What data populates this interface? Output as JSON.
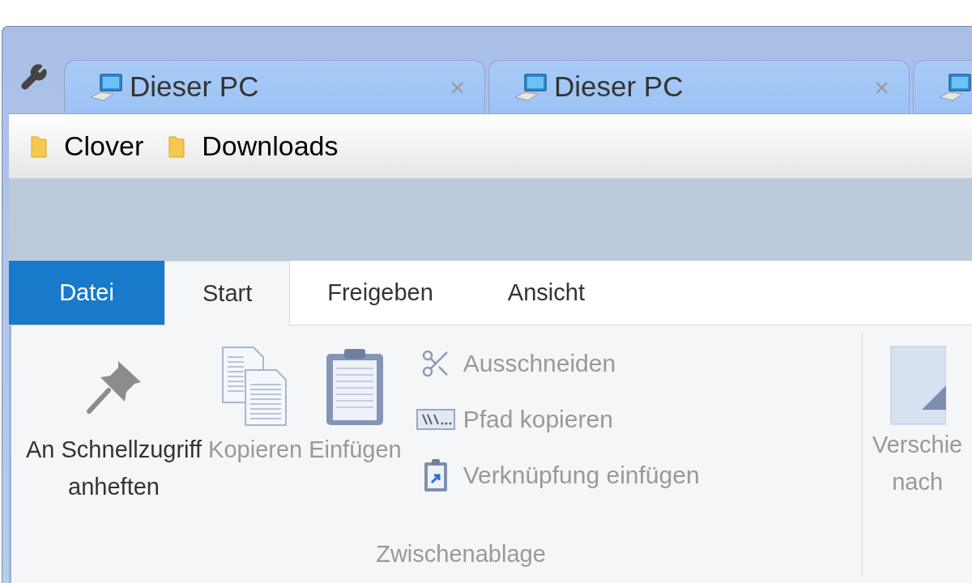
{
  "tabs": [
    {
      "kind": "full",
      "title": "Dieser PC",
      "close": "×"
    },
    {
      "kind": "full",
      "title": "Dieser PC",
      "close": "×"
    },
    {
      "kind": "clipped"
    }
  ],
  "favorites": [
    {
      "label": "Clover"
    },
    {
      "label": "Downloads"
    }
  ],
  "ribbon_tabs": [
    {
      "label": "Datei",
      "kind": "file"
    },
    {
      "label": "Start",
      "kind": "tab",
      "selected": true
    },
    {
      "label": "Freigeben",
      "kind": "tab",
      "selected": false
    },
    {
      "label": "Ansicht",
      "kind": "tab",
      "selected": false
    }
  ],
  "clipboard_group": {
    "label": "Zwischenablage",
    "large_commands": [
      {
        "kind": "pin",
        "lines": [
          "An Schnellzugriff",
          "anheften"
        ],
        "disabled": false
      },
      {
        "kind": "copy",
        "lines": [
          "Kopieren"
        ],
        "disabled": true
      },
      {
        "kind": "paste",
        "lines": [
          "Einfügen"
        ],
        "disabled": true
      }
    ],
    "small_commands": [
      {
        "kind": "cut",
        "label": "Ausschneiden",
        "disabled": true
      },
      {
        "kind": "path",
        "label": "Pfad kopieren",
        "disabled": true
      },
      {
        "kind": "shortcut",
        "label": "Verknüpfung einfügen",
        "disabled": true
      }
    ]
  },
  "next_group": {
    "lines": [
      "Verschie",
      "nach"
    ],
    "disabled": true
  }
}
